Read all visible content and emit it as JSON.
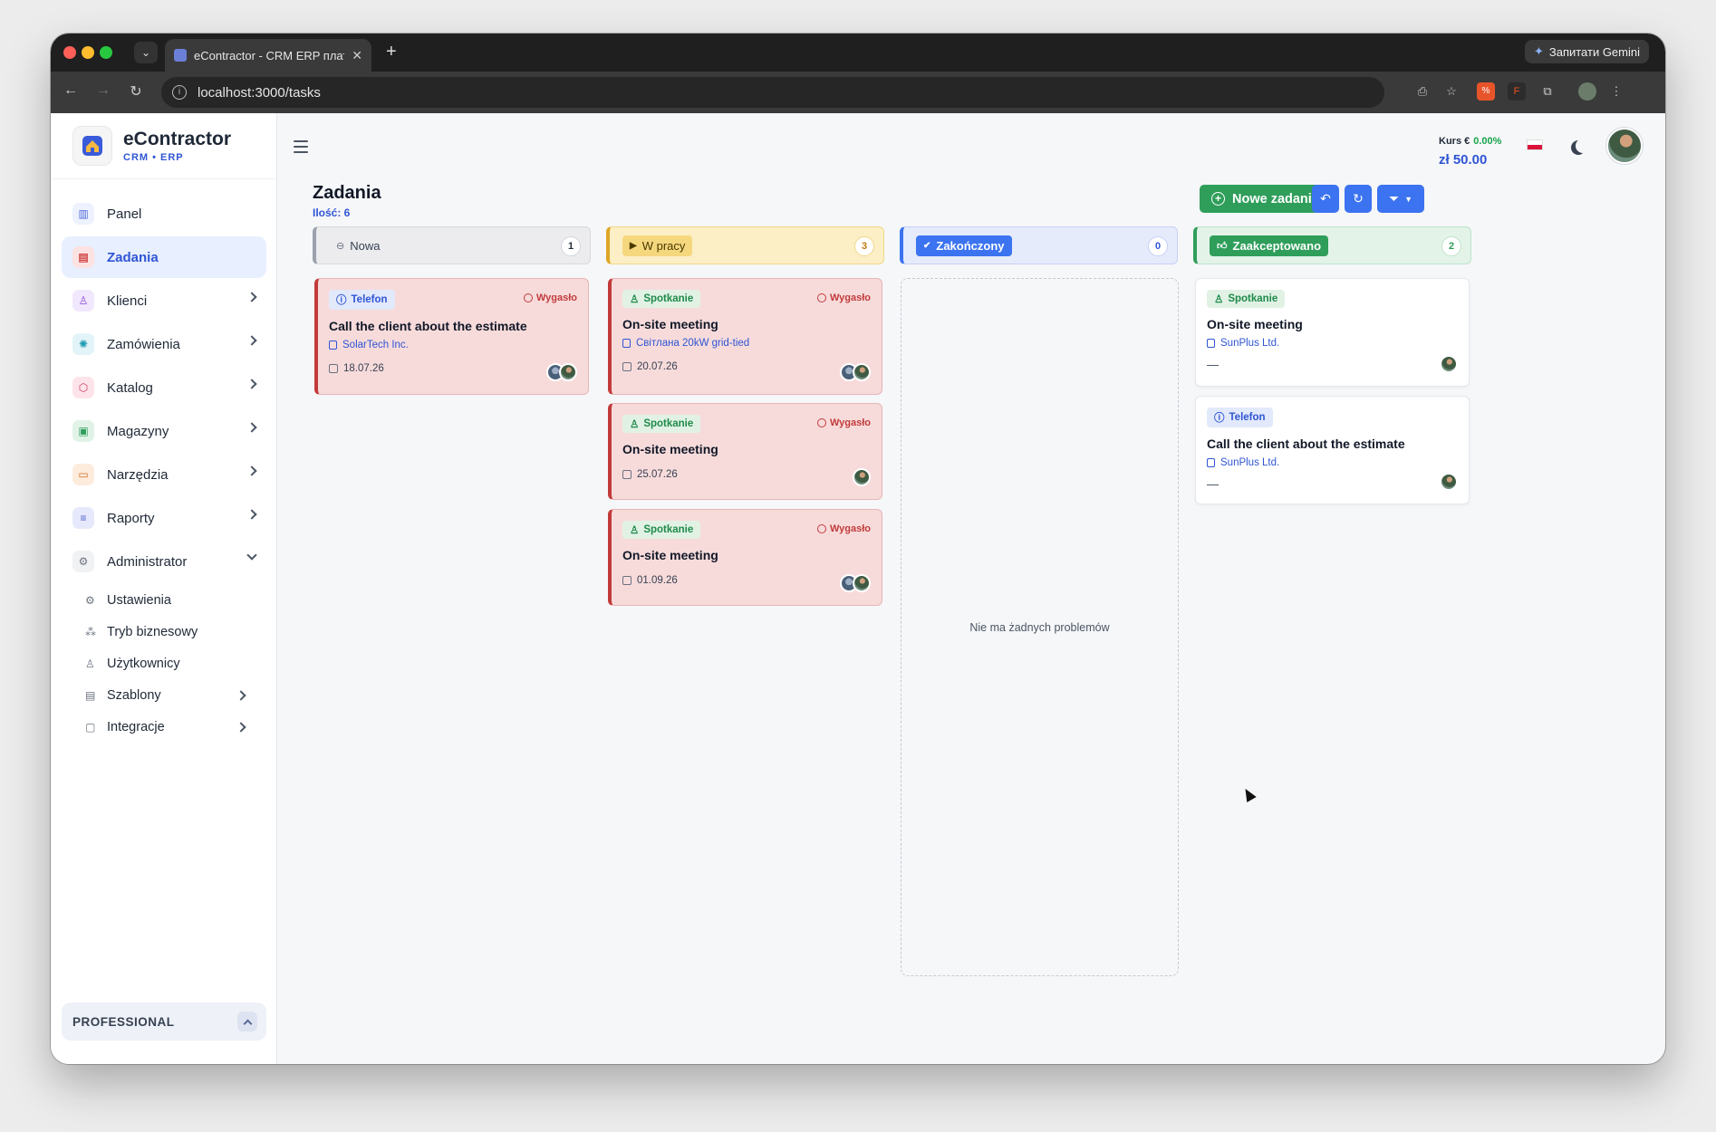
{
  "browser": {
    "tab_title": "eContractor - CRM ERP плат",
    "url": "localhost:3000/tasks",
    "gemini_label": "Запитати Gemini"
  },
  "brand": {
    "name": "eContractor",
    "subtitle": "CRM • ERP"
  },
  "sidebar": {
    "items": [
      {
        "label": "Panel",
        "icon": "chart-bars-icon"
      },
      {
        "label": "Zadania",
        "icon": "clipboard-icon",
        "active": true
      },
      {
        "label": "Klienci",
        "icon": "users-icon"
      },
      {
        "label": "Zamówienia",
        "icon": "sun-icon"
      },
      {
        "label": "Katalog",
        "icon": "box-icon"
      },
      {
        "label": "Magazyny",
        "icon": "warehouse-icon"
      },
      {
        "label": "Narzędzia",
        "icon": "toolbox-icon"
      },
      {
        "label": "Raporty",
        "icon": "report-icon"
      },
      {
        "label": "Administrator",
        "icon": "gear-icon",
        "expanded": true
      }
    ],
    "subitems": [
      {
        "label": "Ustawienia",
        "icon": "gear-icon"
      },
      {
        "label": "Tryb biznesowy",
        "icon": "mode-icon"
      },
      {
        "label": "Użytkownicy",
        "icon": "user-icon"
      },
      {
        "label": "Szablony",
        "icon": "template-icon"
      },
      {
        "label": "Integracje",
        "icon": "plug-icon"
      }
    ],
    "plan": "PROFESSIONAL"
  },
  "header": {
    "rate_label": "Kurs €",
    "rate_change": "0.00%",
    "rate_value": "zł 50.00"
  },
  "page": {
    "title": "Zadania",
    "count": "Ilość: 6",
    "new_task": "Nowe zadanie"
  },
  "columns": [
    {
      "title": "Nowa",
      "count": "1"
    },
    {
      "title": "W pracy",
      "count": "3"
    },
    {
      "title": "Zakończony",
      "count": "0",
      "empty_text": "Nie ma żadnych problemów"
    },
    {
      "title": "Zaakceptowano",
      "count": "2"
    }
  ],
  "cards": {
    "nowa": [
      {
        "type": "Telefon",
        "status": "Wygasło",
        "title": "Call the client about the estimate",
        "link": "SolarTech Inc.",
        "date": "18.07.26"
      }
    ],
    "w_pracy": [
      {
        "type": "Spotkanie",
        "status": "Wygasło",
        "title": "On-site meeting",
        "link": "Світлана 20kW grid-tied",
        "date": "20.07.26"
      },
      {
        "type": "Spotkanie",
        "status": "Wygasło",
        "title": "On-site meeting",
        "date": "25.07.26"
      },
      {
        "type": "Spotkanie",
        "status": "Wygasło",
        "title": "On-site meeting",
        "date": "01.09.26"
      }
    ],
    "zaakceptowano": [
      {
        "type": "Spotkanie",
        "title": "On-site meeting",
        "link": "SunPlus Ltd.",
        "date": "—"
      },
      {
        "type": "Telefon",
        "title": "Call the client about the estimate",
        "link": "SunPlus Ltd.",
        "date": "—"
      }
    ]
  },
  "colors": {
    "primary": "#2f55d4",
    "success": "#2f9e5a",
    "danger": "#c23b3b",
    "button": "#3b73f0"
  }
}
